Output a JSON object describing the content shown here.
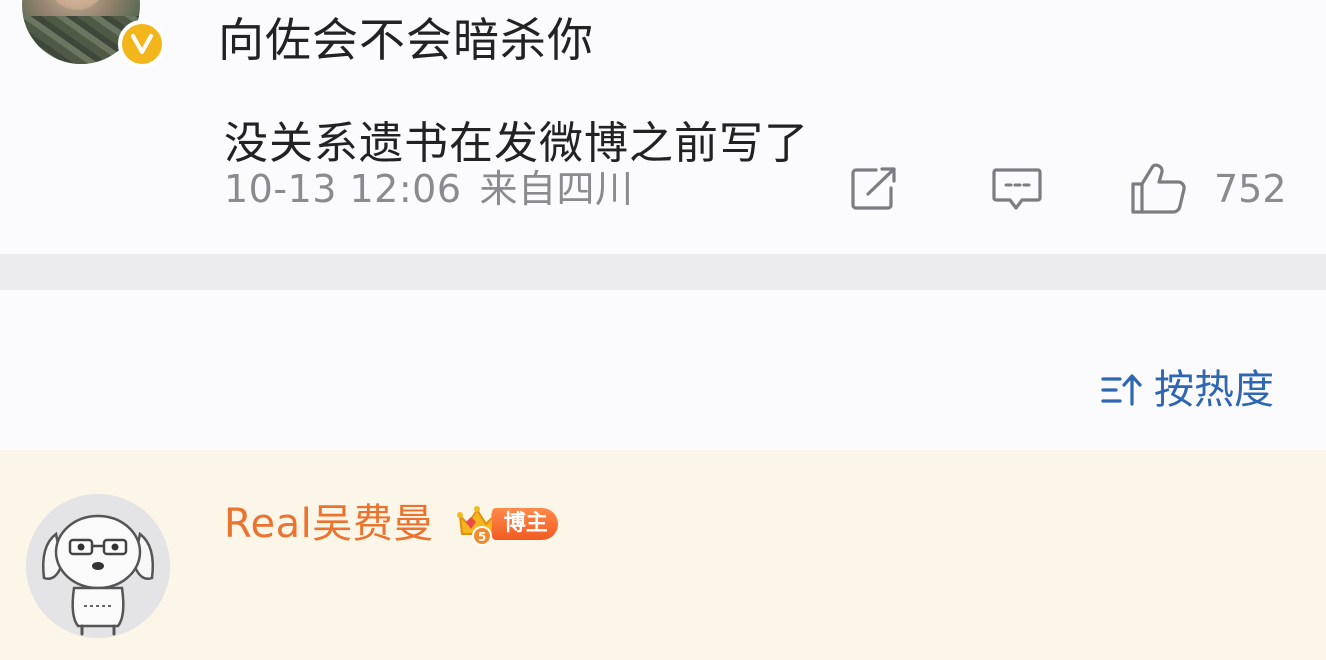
{
  "post": {
    "avatar_icon": "user-avatar-photo",
    "verified_icon": "verified-check-badge",
    "verified_color": "#f3b51c",
    "text": "向佐会不会暗杀你",
    "timestamp": "10-13 12:06",
    "location": "来自四川",
    "actions": {
      "share_icon": "share-external-icon",
      "comment_icon": "comment-bubble-icon",
      "like_icon": "thumbs-up-icon",
      "like_count": "752"
    }
  },
  "sort": {
    "icon": "sort-icon",
    "label": "按热度",
    "color": "#2e66b1"
  },
  "comment": {
    "avatar_icon": "cartoon-dog-avatar",
    "author": "Real吴费曼",
    "author_color": "#eb7330",
    "badge_icon": "crown-icon",
    "badge_label": "博主",
    "text": "没关系遗书在发微博之前写了",
    "highlight_background": "#fcf6e9"
  }
}
